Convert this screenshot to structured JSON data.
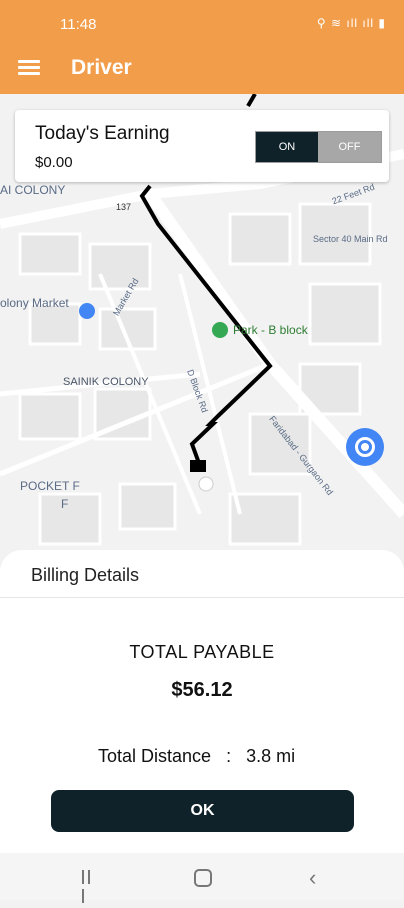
{
  "status_bar": {
    "time": "11:48",
    "icons_right": "⚲ ≋ ıll ıll ▮"
  },
  "app_bar": {
    "title": "Driver"
  },
  "earnings_card": {
    "title": "Today's Earning",
    "amount": "$0.00",
    "toggle_on": "ON",
    "toggle_off": "OFF"
  },
  "map": {
    "labels": {
      "colony": "AI COLONY",
      "market": "olony Market",
      "market_rd": "Market Rd",
      "park": "Park - B block",
      "sainik": "SAINIK COLONY",
      "block_rd": "D Block Rd",
      "pocket": "POCKET F",
      "pocket_f": "F",
      "faridabad_rd": "Faridabad - Gurgaon Rd",
      "sector": "Sector 40 Main Rd",
      "feet_rd": "22 Feet Rd",
      "route_137": "137"
    }
  },
  "billing": {
    "header": "Billing Details",
    "total_label": "TOTAL PAYABLE",
    "total_value": "$56.12",
    "distance_label": "Total Distance",
    "distance_sep": ":",
    "distance_value": "3.8 mi",
    "ok_label": "OK"
  },
  "colors": {
    "accent": "#f29d4a",
    "dark": "#0f2129"
  }
}
